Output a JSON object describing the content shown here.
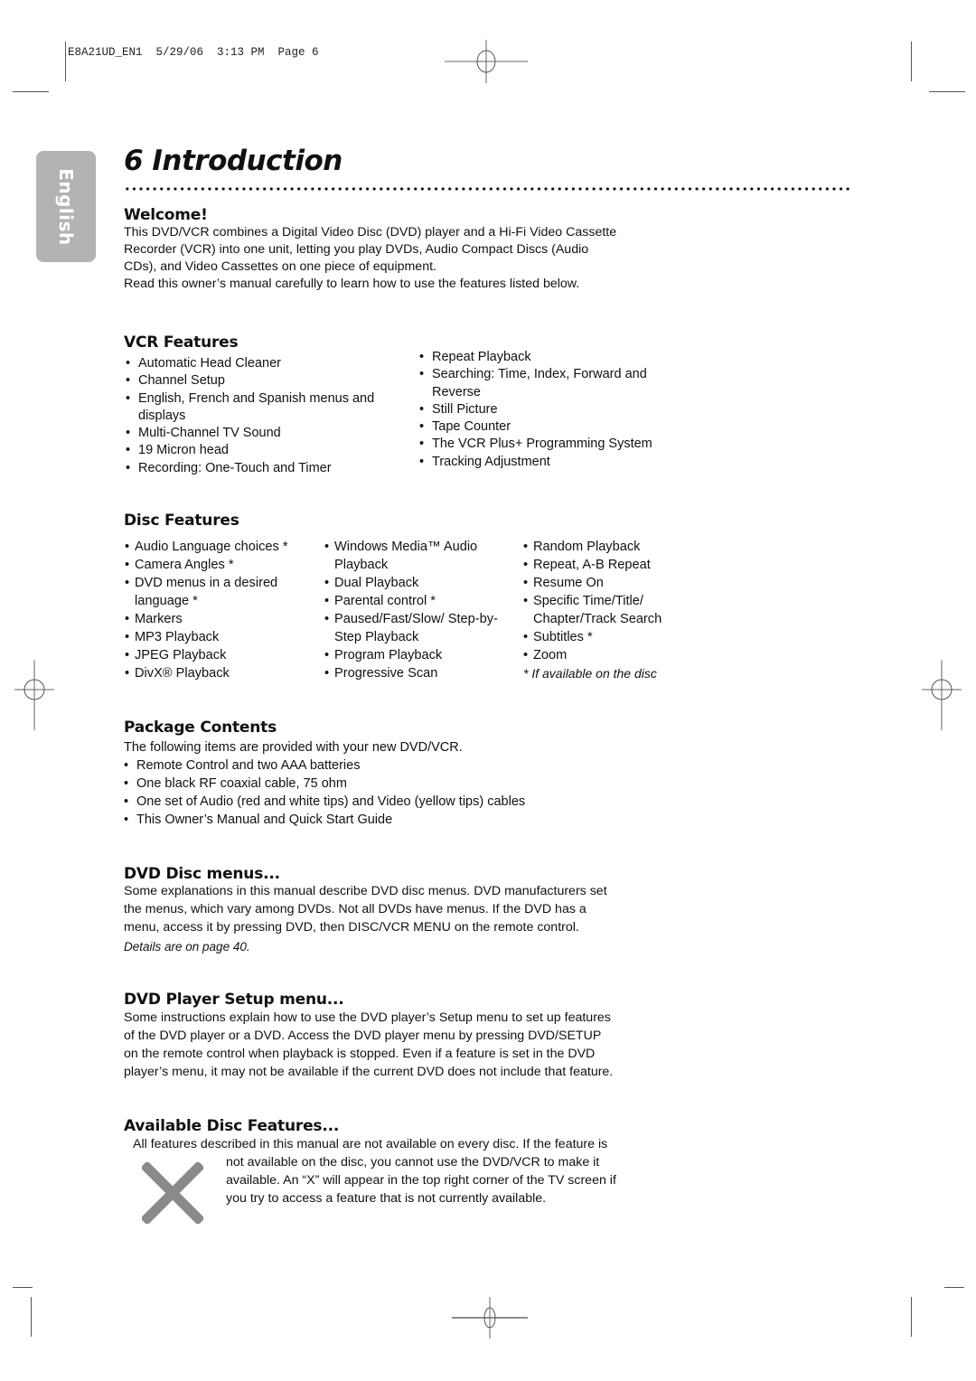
{
  "slug": "E8A21UD_EN1  5/29/06  3:13 PM  Page 6",
  "language_tab": "English",
  "page_title": "6  Introduction",
  "welcome": {
    "heading": "Welcome!",
    "lines": [
      "This DVD/VCR combines a Digital Video Disc (DVD) player and a Hi-Fi Video Cassette",
      "Recorder (VCR) into one unit, letting you play DVDs, Audio Compact Discs (Audio",
      "CDs), and Video Cassettes on one piece of equipment.",
      "Read this owner’s manual carefully to learn how to use the features listed below."
    ]
  },
  "vcr_features": {
    "heading": "VCR Features",
    "col1": [
      "Automatic Head Cleaner",
      "Channel Setup",
      "English, French and Spanish menus and displays",
      "Multi-Channel TV Sound",
      "19 Micron head",
      "Recording: One-Touch and Timer"
    ],
    "col2": [
      "Repeat Playback",
      "Searching: Time, Index, Forward and Reverse",
      "Still Picture",
      "Tape Counter",
      "The VCR Plus+ Programming  System",
      "Tracking Adjustment"
    ]
  },
  "disc_features": {
    "heading": "Disc Features",
    "col1": [
      "Audio Language choices *",
      "Camera Angles *",
      "DVD menus in a desired language *",
      "Markers",
      "MP3 Playback",
      "JPEG Playback",
      "DivX® Playback"
    ],
    "col2": [
      "Windows Media™ Audio Playback",
      "Dual Playback",
      "Parental control *",
      "Paused/Fast/Slow/ Step-by-Step Playback",
      "Program Playback",
      "Progressive Scan"
    ],
    "col3": [
      "Random Playback",
      "Repeat, A-B Repeat",
      "Resume On",
      "Specific Time/Title/ Chapter/Track Search",
      "Subtitles *",
      "Zoom"
    ],
    "footnote": "* If available on the disc"
  },
  "package_contents": {
    "heading": "Package Contents",
    "intro": "The following items are provided with your new DVD/VCR.",
    "items": [
      "Remote Control and two AAA batteries",
      "One black RF coaxial cable, 75 ohm",
      "One set of Audio (red and white tips) and Video (yellow tips) cables",
      "This Owner’s Manual and Quick Start Guide"
    ]
  },
  "dvd_disc_menus": {
    "heading": "DVD Disc menus...",
    "lines": [
      "Some explanations in this manual describe DVD disc menus. DVD manufacturers set",
      "the menus, which vary among DVDs. Not all DVDs have menus. If the DVD has a",
      "menu, access it by pressing DVD, then DISC/VCR MENU on the remote control."
    ],
    "details": "Details are on page 40."
  },
  "dvd_setup_menu": {
    "heading": "DVD Player Setup menu...",
    "lines": [
      "Some instructions explain how to use the DVD player’s Setup menu to set up features",
      "of the DVD player or a DVD. Access the DVD player menu by pressing DVD/SETUP",
      "on the remote control when playback is stopped. Even if a feature is set in the DVD",
      "player’s menu, it may not be available if the current DVD does not include that feature."
    ]
  },
  "available_disc_features": {
    "heading": "Available Disc Features...",
    "line1": "All features described in this manual are not available on every disc. If the feature is",
    "lines": [
      "not available on the disc, you cannot use the DVD/VCR to make it",
      "available. An “X” will appear in the top right corner of the TV screen if",
      "you try to access a feature that is not currently available."
    ],
    "icon": "x-mark-icon",
    "icon_color": "#8a8a8a"
  },
  "colors": {
    "tab_background": "#b3b3b3",
    "text": "#111111"
  }
}
